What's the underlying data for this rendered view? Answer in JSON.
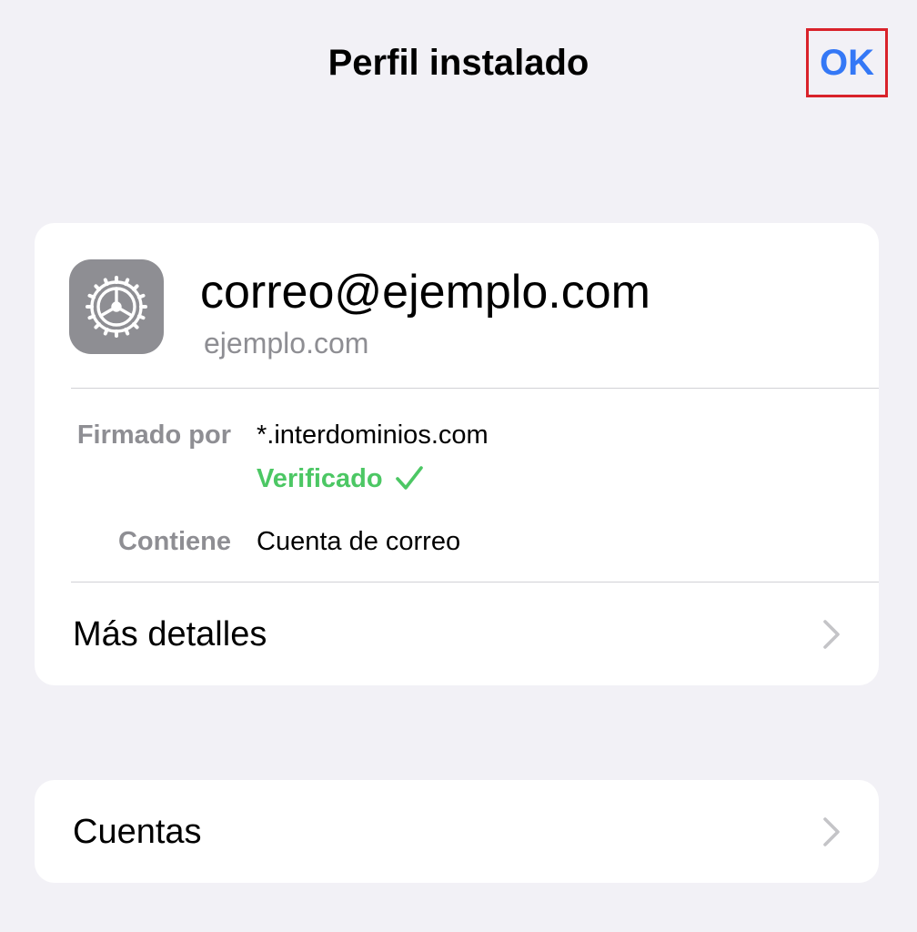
{
  "nav": {
    "title": "Perfil instalado",
    "ok_label": "OK"
  },
  "profile": {
    "icon": "settings-gear-icon",
    "name": "correo@ejemplo.com",
    "domain": "ejemplo.com",
    "signed_label": "Firmado por",
    "signed_value": "*.interdominios.com",
    "verified_label": "Verificado",
    "contains_label": "Contiene",
    "contains_value": "Cuenta de correo",
    "details_label": "Más detalles"
  },
  "accounts": {
    "label": "Cuentas"
  },
  "colors": {
    "accent": "#3478f6",
    "verified": "#4cc764",
    "highlight_box": "#d9222a",
    "background": "#f2f1f6"
  }
}
